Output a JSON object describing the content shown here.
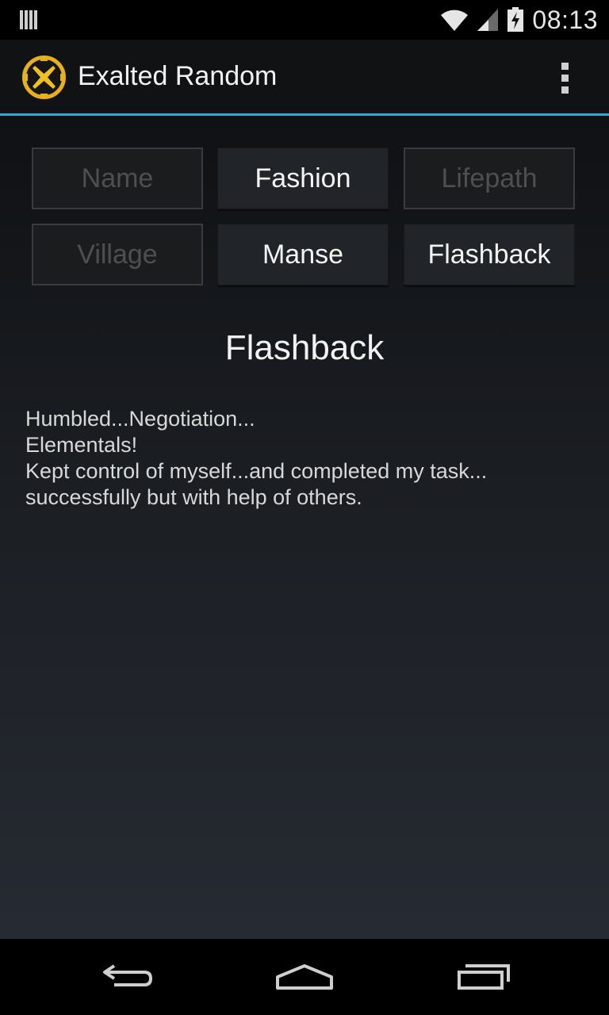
{
  "status_bar": {
    "time": "08:13",
    "icons": [
      "notification-bars-icon",
      "wifi-icon",
      "signal-icon",
      "battery-charging-icon"
    ]
  },
  "action_bar": {
    "title": "Exalted Random",
    "logo_icon": "exalted-x-logo",
    "overflow_icon": "overflow-menu-icon",
    "accent_color": "#33a5d8"
  },
  "buttons": [
    {
      "label": "Name",
      "enabled": false
    },
    {
      "label": "Fashion",
      "enabled": true
    },
    {
      "label": "Lifepath",
      "enabled": false
    },
    {
      "label": "Village",
      "enabled": false
    },
    {
      "label": "Manse",
      "enabled": true
    },
    {
      "label": "Flashback",
      "enabled": true
    }
  ],
  "result": {
    "title": "Flashback",
    "lines": [
      "Humbled...Negotiation...",
      "Elementals!",
      "Kept control of myself...and completed my task...",
      "successfully but with help of others."
    ]
  },
  "nav_bar": {
    "icons": [
      "back-icon",
      "home-icon",
      "recent-apps-icon"
    ]
  }
}
